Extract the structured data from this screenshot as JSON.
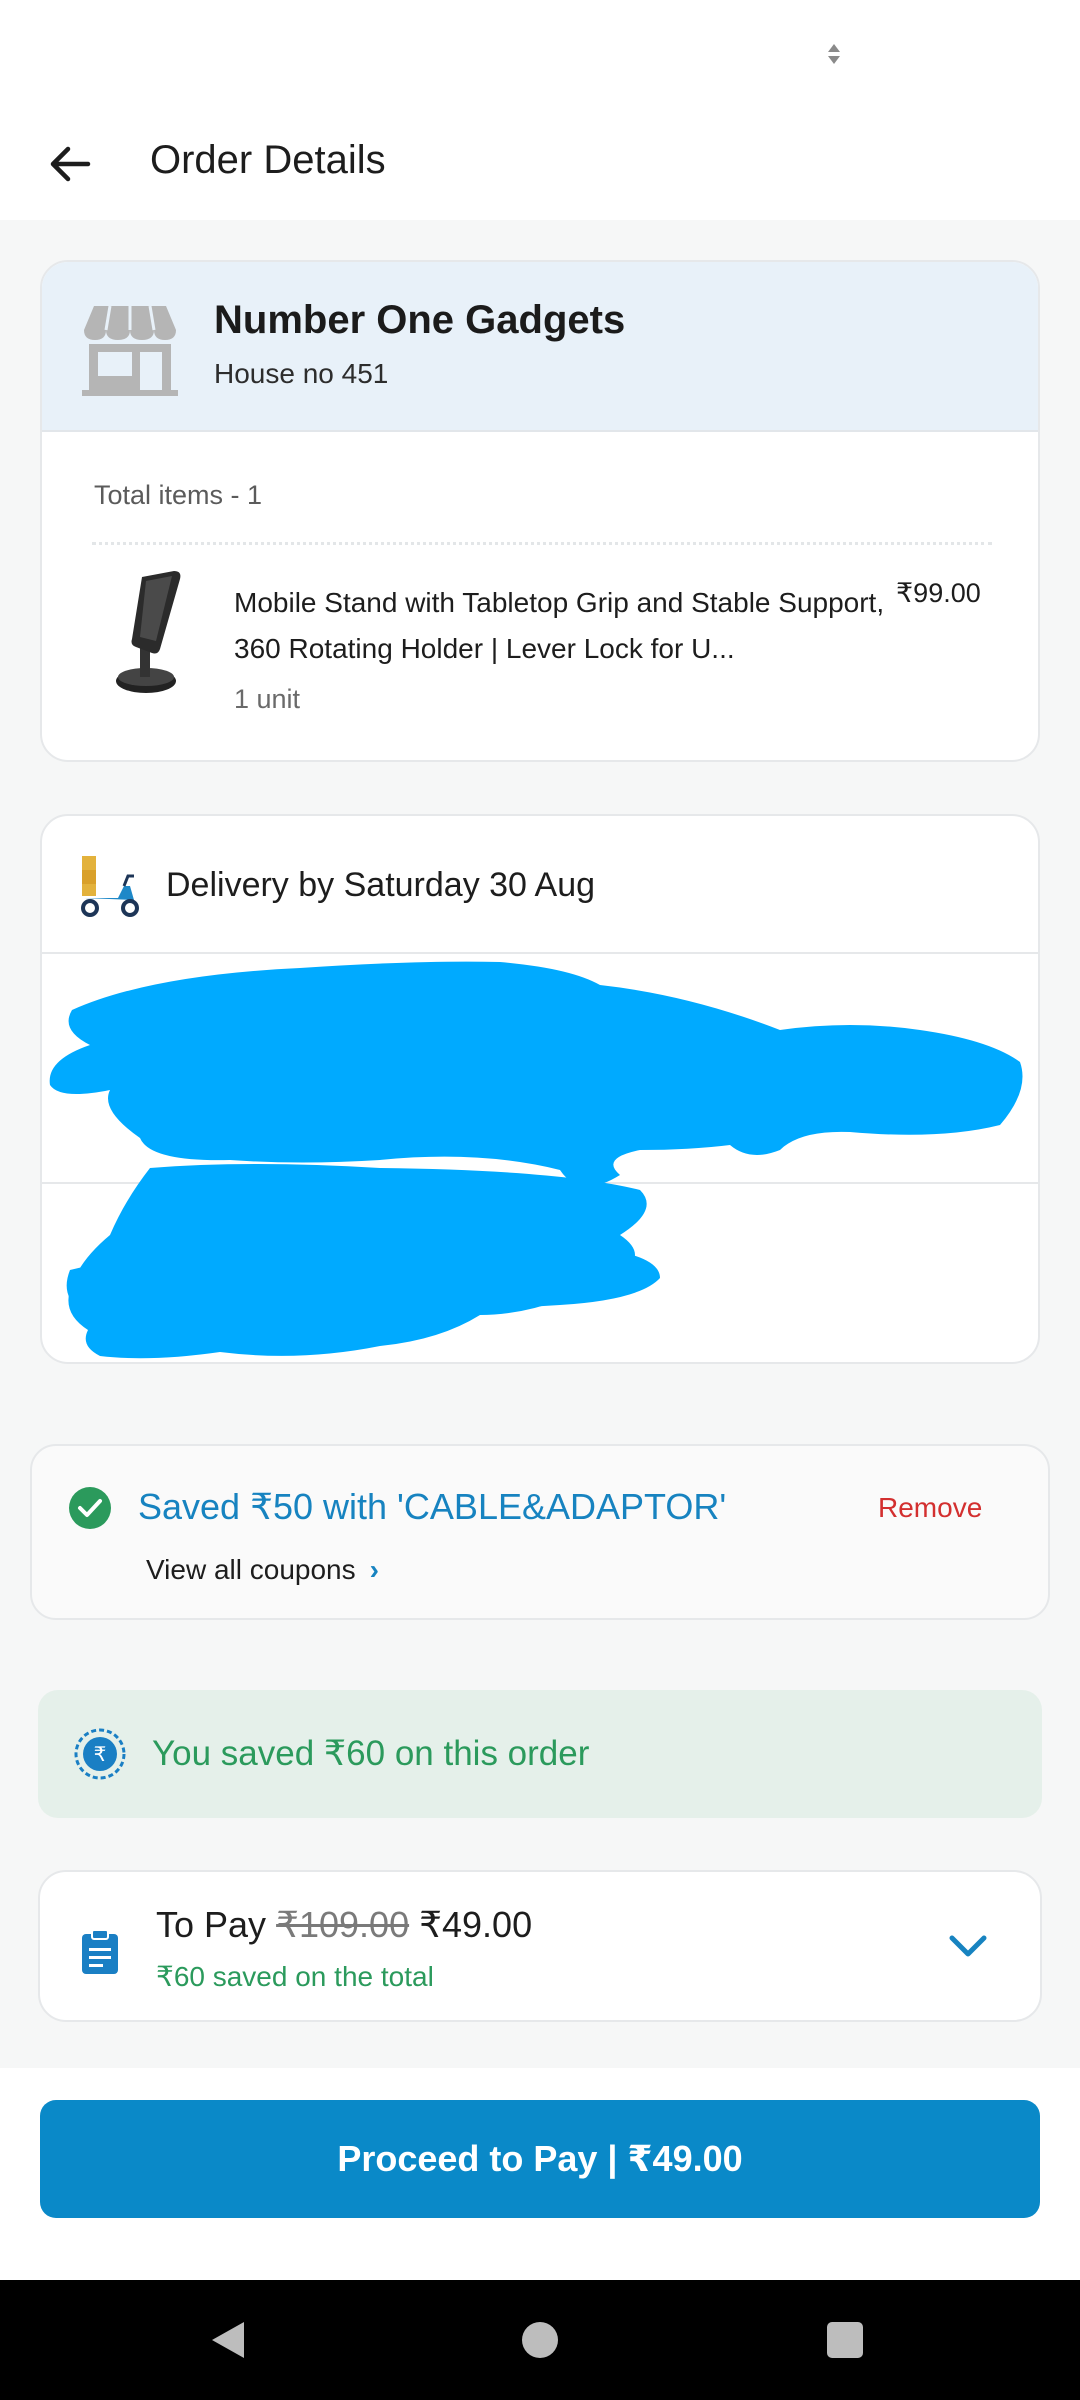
{
  "header": {
    "title": "Order Details"
  },
  "store": {
    "name": "Number One Gadgets",
    "address": "House no 451",
    "total_items": "Total items - 1"
  },
  "item": {
    "name": "Mobile Stand with Tabletop Grip and Stable Support, 360 Rotating Holder | Lever Lock for U...",
    "price": "₹99.00",
    "qty": "1 unit"
  },
  "delivery": {
    "prefix": "Delivery by ",
    "date": "Saturday 30 Aug"
  },
  "coupon": {
    "saved_text": "Saved ₹50 with 'CABLE&ADAPTOR'",
    "remove_label": "Remove",
    "view_all_label": "View all coupons"
  },
  "savings": {
    "text": "You saved ₹60 on this order"
  },
  "payment": {
    "label": "To Pay",
    "old_price": "₹109.00",
    "new_price": "₹49.00",
    "saved_text": "₹60 saved on the total"
  },
  "cta": {
    "label": "Proceed to Pay | ₹49.00"
  },
  "colors": {
    "accent": "#0a89c8",
    "success": "#2b9a5c",
    "danger": "#d32f2f",
    "redaction": "#00aaff"
  }
}
